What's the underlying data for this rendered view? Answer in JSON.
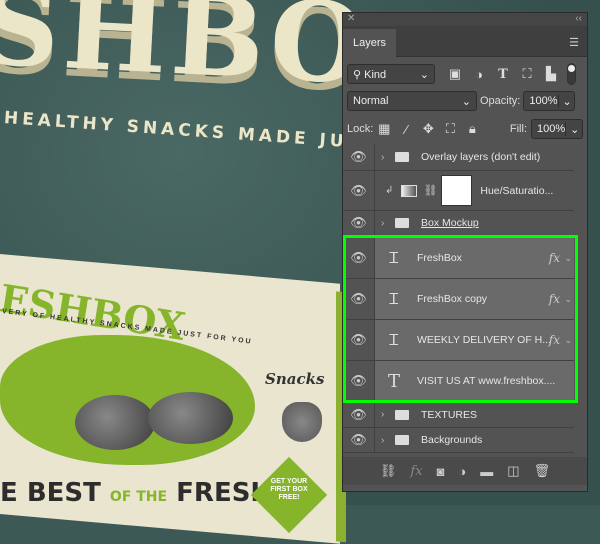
{
  "artwork": {
    "headline": "SHBO",
    "tagline": "HEALTHY SNACKS MADE JUS",
    "box_title": "ESHBOX",
    "box_subtitle": "VERY OF HEALTHY SNACKS MADE JUST FOR YOU",
    "snacks": "Snacks",
    "slogan_a": "E BEST",
    "slogan_b": "OF THE",
    "slogan_c": "FRESH",
    "promo": "GET YOUR FIRST BOX FREE!",
    "accent_color": "#86b52c"
  },
  "panel": {
    "close": "✕",
    "collapse": "‹‹",
    "tab": "Layers",
    "menu_icon": "hamburger-icon",
    "filter": {
      "label": "Kind",
      "icons": [
        "image-filter-icon",
        "adjustment-filter-icon",
        "type-filter-icon",
        "shape-filter-icon",
        "smart-object-filter-icon"
      ]
    },
    "blend_mode": "Normal",
    "opacity_label": "Opacity:",
    "opacity": "100%",
    "lock_label": "Lock:",
    "fill_label": "Fill:",
    "fill": "100%",
    "layers": [
      {
        "name": "Overlay layers (don't edit)",
        "type": "group",
        "selected": false
      },
      {
        "name": "Hue/Saturatio...",
        "type": "adjustment",
        "selected": false
      },
      {
        "name": "Box Mockup",
        "type": "group",
        "selected": false
      },
      {
        "name": "FreshBox",
        "type": "warped-text",
        "fx": "fx",
        "selected": true
      },
      {
        "name": "FreshBox copy",
        "type": "warped-text",
        "fx": "fx",
        "selected": true
      },
      {
        "name": "WEEKLY DELIVERY OF H...",
        "type": "warped-text",
        "fx": "fx",
        "selected": true
      },
      {
        "name": "VISIT US AT www.freshbox....",
        "type": "text",
        "selected": true
      },
      {
        "name": "TEXTURES",
        "type": "group",
        "selected": false
      },
      {
        "name": "Backgrounds",
        "type": "group",
        "selected": false
      }
    ],
    "highlight_color": "#00ff00"
  }
}
